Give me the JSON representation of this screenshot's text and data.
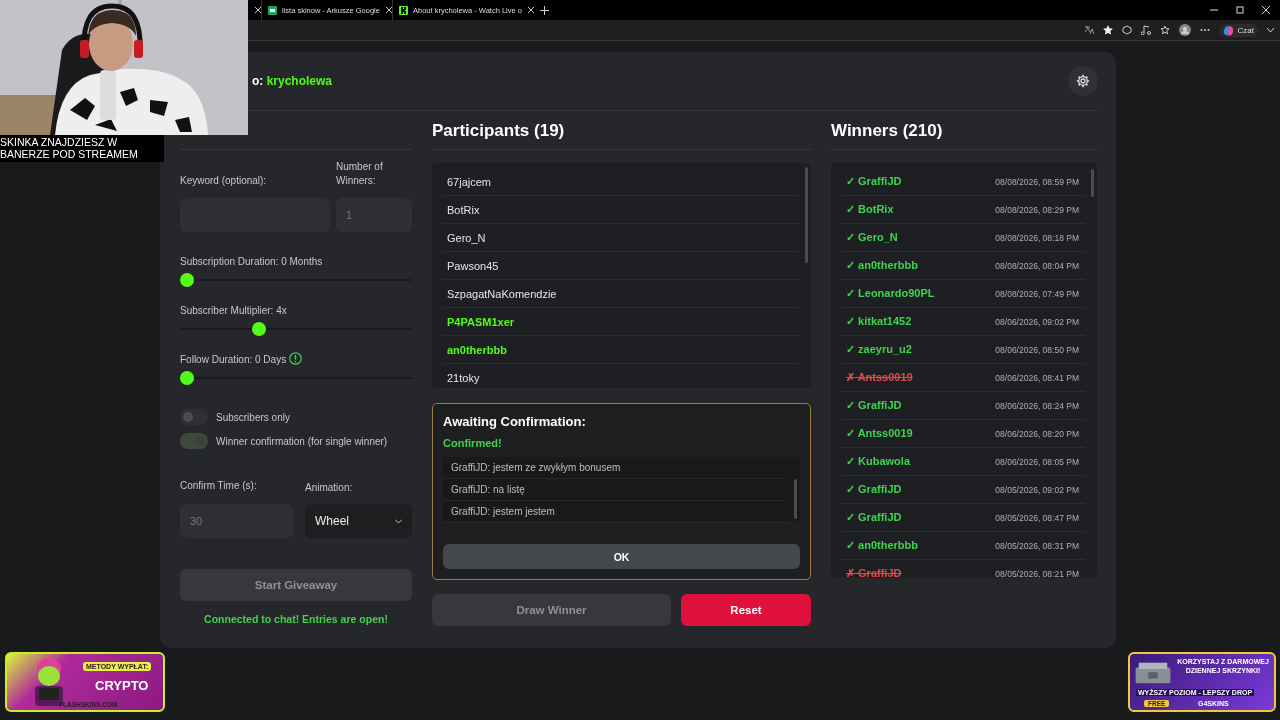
{
  "browser": {
    "tabs": [
      {
        "title": "lista skinow - Arkusze Google",
        "selected": false
      },
      {
        "title": "About krycholewa - Watch Live o",
        "selected": false
      }
    ],
    "copilot_label": "Czat"
  },
  "header": {
    "prefix": "o: ",
    "channel": "krycholewa"
  },
  "settings": {
    "keyword": {
      "label": "Keyword (optional):"
    },
    "winners_count": {
      "label": "Number of Winners:",
      "placeholder": "1"
    },
    "sliders": [
      {
        "label": "Subscription Duration: 0 Months",
        "level": 0,
        "info": false
      },
      {
        "label": "Subscriber Multiplier: 4x",
        "level": 0.33,
        "info": false
      },
      {
        "label": "Follow Duration:  0  Days",
        "level": 0,
        "info": true
      }
    ],
    "toggles": [
      {
        "label": "Subscribers only",
        "on": false
      },
      {
        "label": "Winner confirmation (for single winner)",
        "on": true
      }
    ],
    "confirm_time": {
      "label": "Confirm Time (s):",
      "placeholder": "30"
    },
    "animation": {
      "label": "Animation:",
      "value": "Wheel"
    },
    "start_button": {
      "label": "Start Giveaway",
      "disabled": true
    },
    "status": "Connected to chat! Entries are open!"
  },
  "participants": {
    "title": "Participants (19)",
    "items": [
      {
        "name": "67jajcem",
        "highlighted": false
      },
      {
        "name": "BotRix",
        "highlighted": false
      },
      {
        "name": "Gero_N",
        "highlighted": false
      },
      {
        "name": "Pawson45",
        "highlighted": false
      },
      {
        "name": "SzpagatNaKomendzie",
        "highlighted": false
      },
      {
        "name": "P4PASM1xer",
        "highlighted": true
      },
      {
        "name": "an0therbbb",
        "highlighted": true
      },
      {
        "name": "21toky",
        "highlighted": false
      }
    ]
  },
  "confirmation": {
    "title": "Awaiting Confirmation:",
    "status": "Confirmed!",
    "messages": [
      "GraffiJD: jestem ze zwykłym bonusem",
      "GraffiJD: na listę",
      "GraffiJD: jestem jestem"
    ],
    "ok_button": "OK"
  },
  "actions": {
    "draw_button": {
      "label": "Draw Winner",
      "disabled": true
    },
    "reset_button": "Reset"
  },
  "winners": {
    "title": "Winners (210)",
    "items": [
      {
        "name": "✓ GraffiJD",
        "date": "08/08/2026, 08:59 PM",
        "confirmed": true
      },
      {
        "name": "✓ BotRix",
        "date": "08/08/2026, 08:29 PM",
        "confirmed": true
      },
      {
        "name": "✓ Gero_N",
        "date": "08/08/2026, 08:18 PM",
        "confirmed": true
      },
      {
        "name": "✓ an0therbbb",
        "date": "08/08/2026, 08:04 PM",
        "confirmed": true
      },
      {
        "name": "✓ Leonardo90PL",
        "date": "08/08/2026, 07:49 PM",
        "confirmed": true
      },
      {
        "name": "✓ kitkat1452",
        "date": "08/06/2026, 09:02 PM",
        "confirmed": true
      },
      {
        "name": "✓ zaeyru_u2",
        "date": "08/06/2026, 08:50 PM",
        "confirmed": true
      },
      {
        "name": "✗ Antss0019",
        "date": "08/06/2026, 08:41 PM",
        "confirmed": false
      },
      {
        "name": "✓ GraffiJD",
        "date": "08/06/2026, 08:24 PM",
        "confirmed": true
      },
      {
        "name": "✓ Antss0019",
        "date": "08/06/2026, 08:20 PM",
        "confirmed": true
      },
      {
        "name": "✓ Kubawola",
        "date": "08/06/2026, 08:05 PM",
        "confirmed": true
      },
      {
        "name": "✓ GraffiJD",
        "date": "08/05/2026, 09:02 PM",
        "confirmed": true
      },
      {
        "name": "✓ GraffiJD",
        "date": "08/05/2026, 08:47 PM",
        "confirmed": true
      },
      {
        "name": "✓ an0therbbb",
        "date": "08/05/2026, 08:31 PM",
        "confirmed": true
      },
      {
        "name": "✗ GraffiJD",
        "date": "08/05/2026, 08:21 PM",
        "confirmed": false
      }
    ]
  },
  "overlay": {
    "caption": "SKINKA ZNAJDZIESZ W BANERZE POD STREAMEM",
    "left_ad": {
      "heading": "METODY WYPŁAT:",
      "main": "CRYPTO",
      "footer": "FLASHSKINS.COM"
    },
    "right_ad": {
      "heading": "KORZYSTAJ Z DARMOWEJ DZIENNEJ SKRZYNKI!",
      "sub": "WYŻSZY POZIOM - LEPSZY DROP",
      "badge": "FREE",
      "brand": "G4SKINS"
    }
  }
}
